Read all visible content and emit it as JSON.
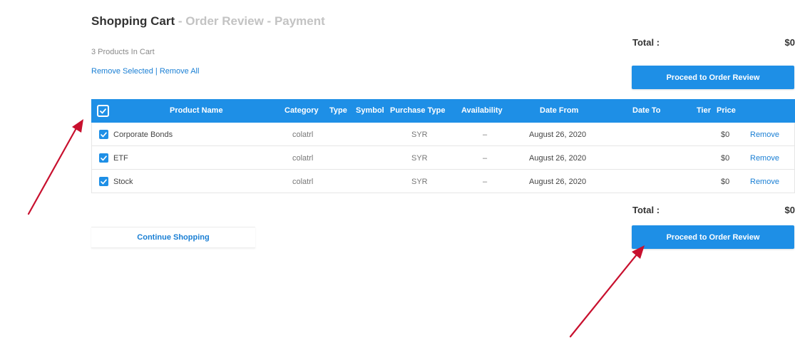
{
  "breadcrumb": {
    "active": "Shopping Cart",
    "separator": " - ",
    "step2": "Order Review",
    "step3": "Payment"
  },
  "cart": {
    "count_text": "3 Products In Cart",
    "remove_selected": "Remove Selected",
    "divider": " | ",
    "remove_all": "Remove All"
  },
  "totals": {
    "label": "Total :",
    "value": "$0"
  },
  "buttons": {
    "proceed": "Proceed to Order Review",
    "continue_shopping": "Continue Shopping"
  },
  "table": {
    "columns": {
      "product_name": "Product Name",
      "category": "Category",
      "type": "Type",
      "symbol": "Symbol",
      "purchase_type": "Purchase Type",
      "availability": "Availability",
      "date_from": "Date From",
      "date_to": "Date To",
      "tier": "Tier",
      "price": "Price"
    },
    "rows": [
      {
        "checked": true,
        "product": "Corporate Bonds",
        "category": "colatrl",
        "purchase_type": "SYR",
        "availability": "–",
        "date_from": "August 26, 2020",
        "date_to": "",
        "tier": "",
        "price": "$0",
        "action": "Remove"
      },
      {
        "checked": true,
        "product": "ETF",
        "category": "colatrl",
        "purchase_type": "SYR",
        "availability": "–",
        "date_from": "August 26, 2020",
        "date_to": "",
        "tier": "",
        "price": "$0",
        "action": "Remove"
      },
      {
        "checked": true,
        "product": "Stock",
        "category": "colatrl",
        "purchase_type": "SYR",
        "availability": "–",
        "date_from": "August 26, 2020",
        "date_to": "",
        "tier": "",
        "price": "$0",
        "action": "Remove"
      }
    ]
  },
  "colors": {
    "accent": "#1e8fe6",
    "link": "#1a7fd4",
    "annotation_arrow": "#c8102e"
  },
  "icons": {
    "checkbox": "check-icon",
    "annotation": "arrow-icon"
  }
}
